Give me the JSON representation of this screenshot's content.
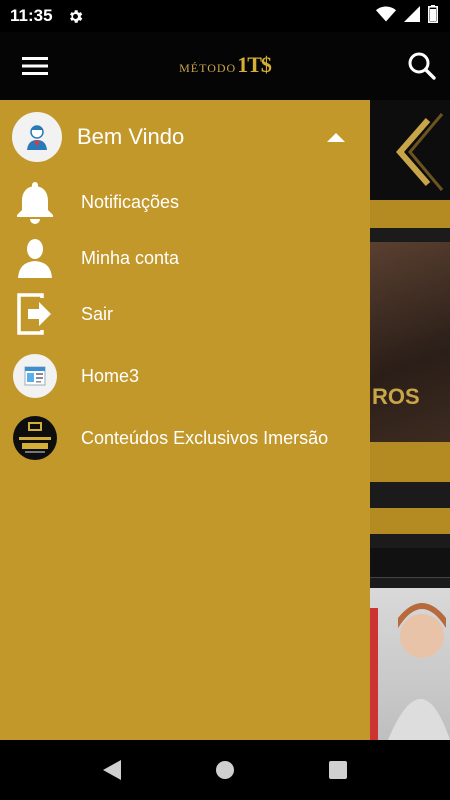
{
  "status_bar": {
    "time": "11:35",
    "icons": [
      "settings-icon",
      "wifi-icon",
      "signal-icon",
      "battery-icon"
    ]
  },
  "app_bar": {
    "logo_text": "MÉTODO",
    "logo_mark": "1T$",
    "icons": [
      "hamburger-menu-icon",
      "search-icon"
    ]
  },
  "drawer": {
    "header": {
      "welcome": "Bem Vindo",
      "avatar_icon": "user-avatar-icon",
      "toggle_icon": "caret-up-icon"
    },
    "items": [
      {
        "label": "Notificações",
        "icon": "bell-icon"
      },
      {
        "label": "Minha conta",
        "icon": "user-icon"
      },
      {
        "label": "Sair",
        "icon": "logout-icon"
      },
      {
        "label": "Home3",
        "icon": "home3-thumbnail-icon"
      },
      {
        "label": "Conteúdos Exclusivos Imersão",
        "icon": "exclusive-content-thumbnail-icon"
      }
    ]
  },
  "background": {
    "visible_text": "ROS"
  },
  "nav_bar": {
    "icons": [
      "back-icon",
      "home-icon",
      "recents-icon"
    ]
  },
  "colors": {
    "drawer": "#c3982a",
    "gold_accent": "#d4af37",
    "app_bar": "#050505"
  }
}
